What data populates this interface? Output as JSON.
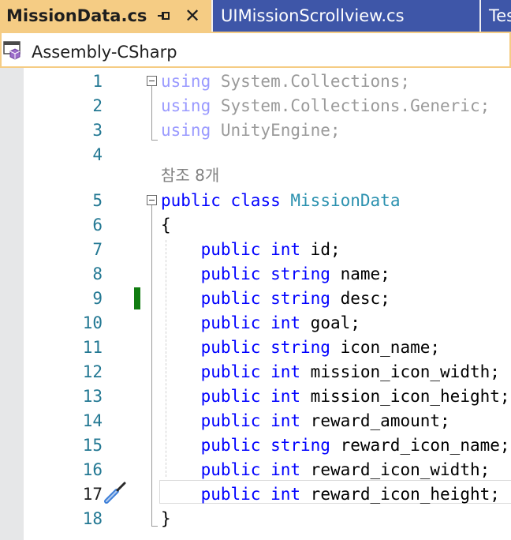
{
  "tabs": [
    {
      "label": "MissionData.cs",
      "active": true
    },
    {
      "label": "UIMissionScrollview.cs",
      "active": false
    },
    {
      "label": "Tes",
      "active": false
    }
  ],
  "nav": {
    "project_label": "Assembly-CSharp"
  },
  "editor": {
    "codelens_refs": "참조 8개",
    "current_line": 17,
    "lines": [
      {
        "num": "1",
        "k1": "using",
        "t1": " System.Collections;"
      },
      {
        "num": "2",
        "k1": "using",
        "t1": " System.Collections.Generic;"
      },
      {
        "num": "3",
        "k1": "using",
        "t1": " UnityEngine;"
      },
      {
        "num": "4"
      },
      {
        "num": "5",
        "k1": "public",
        "sp1": " ",
        "k2": "class",
        "sp2": " ",
        "ty": "MissionData"
      },
      {
        "num": "6",
        "t1": "{"
      },
      {
        "num": "7",
        "indent": "    ",
        "k1": "public",
        "sp1": " ",
        "k2": "int",
        "t1": " id;"
      },
      {
        "num": "8",
        "indent": "    ",
        "k1": "public",
        "sp1": " ",
        "k2": "string",
        "t1": " name;"
      },
      {
        "num": "9",
        "indent": "    ",
        "k1": "public",
        "sp1": " ",
        "k2": "string",
        "t1": " desc;"
      },
      {
        "num": "10",
        "indent": "    ",
        "k1": "public",
        "sp1": " ",
        "k2": "int",
        "t1": " goal;"
      },
      {
        "num": "11",
        "indent": "    ",
        "k1": "public",
        "sp1": " ",
        "k2": "string",
        "t1": " icon_name;"
      },
      {
        "num": "12",
        "indent": "    ",
        "k1": "public",
        "sp1": " ",
        "k2": "int",
        "t1": " mission_icon_width;"
      },
      {
        "num": "13",
        "indent": "    ",
        "k1": "public",
        "sp1": " ",
        "k2": "int",
        "t1": " mission_icon_height;"
      },
      {
        "num": "14",
        "indent": "    ",
        "k1": "public",
        "sp1": " ",
        "k2": "int",
        "t1": " reward_amount;"
      },
      {
        "num": "15",
        "indent": "    ",
        "k1": "public",
        "sp1": " ",
        "k2": "string",
        "t1": " reward_icon_name;"
      },
      {
        "num": "16",
        "indent": "    ",
        "k1": "public",
        "sp1": " ",
        "k2": "int",
        "t1": " reward_icon_width;"
      },
      {
        "num": "17",
        "indent": "    ",
        "k1": "public",
        "sp1": " ",
        "k2": "int",
        "t1": " reward_icon_height;"
      },
      {
        "num": "18",
        "t1": "}"
      }
    ]
  },
  "colors": {
    "active_tab": "#f5cc84",
    "inactive_tab": "#3e56a8",
    "keyword": "#0000ff",
    "type": "#2b91af",
    "line_number": "#237893",
    "change_marker": "#107c10"
  }
}
